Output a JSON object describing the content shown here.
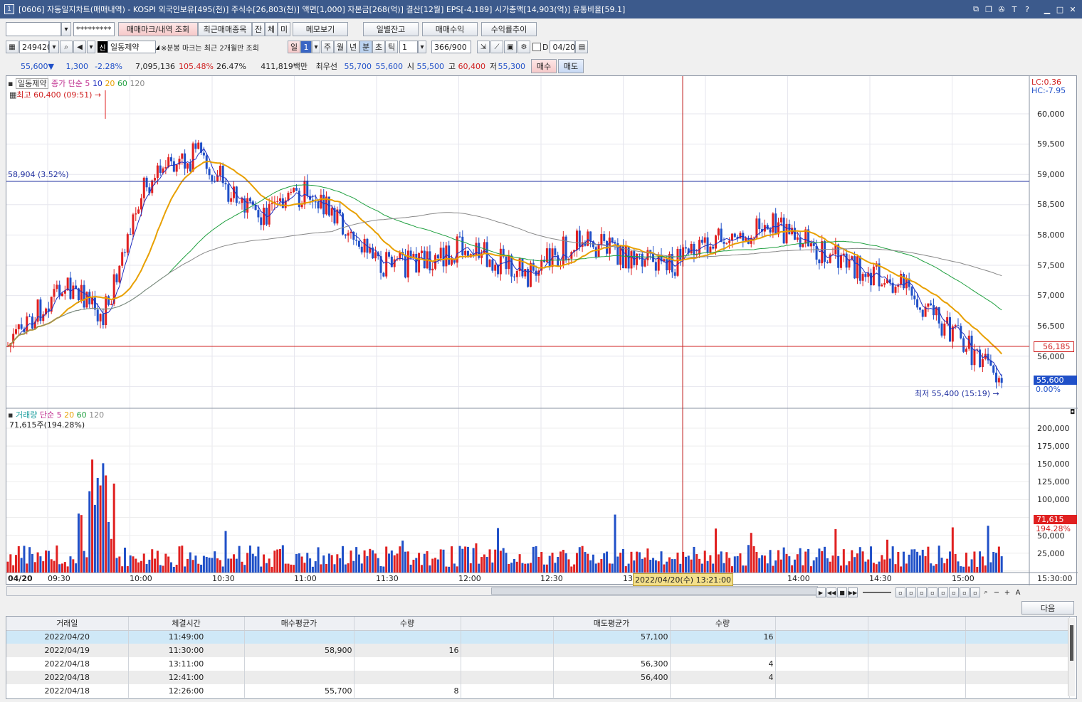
{
  "window": {
    "title": "[0606] 자동일지차트(매매내역) - KOSPI 외국인보유[495(천)] 주식수[26,803(천)] 액면[1,000] 자본금[268(억)] 결산[12월] EPS[-4,189] 시가총액[14,903(억)] 유통비율[59.1]",
    "icon_label": "1"
  },
  "toolbar1": {
    "account_value": "",
    "password_mask": "*********",
    "trade_mark_button": "매매마크/내역 조회",
    "recent_items_button": "최근매매종목",
    "tab_jan": "잔",
    "tab_che": "체",
    "tab_mi": "미",
    "memo_button": "메모보기",
    "daily_balance_button": "일별잔고",
    "trade_profit_button": "매매수익",
    "return_trend_button": "수익률추이"
  },
  "toolbar2": {
    "stock_code": "249420",
    "stock_badge": "신",
    "stock_name": "일동제약",
    "notice": "※분봉 마크는 최근 2개월만 조회",
    "period_day": "일",
    "period_num": "1",
    "period_week": "주",
    "period_month": "월",
    "period_year": "년",
    "period_minute": "분",
    "period_second": "초",
    "period_tick": "틱",
    "interval_value": "1",
    "count_value": "366/900",
    "date_checkbox_label": "D",
    "date_value": "04/20"
  },
  "quote": {
    "price": "55,600▼",
    "change": "1,300",
    "change_pct": "-2.28%",
    "volume": "7,095,136",
    "vol_ratio": "105.48%",
    "turnover": "26.47%",
    "amount": "411,819백만",
    "best_label": "최우선",
    "ask": "55,700",
    "bid": "55,600",
    "open_label": "시",
    "open": "55,500",
    "high_label": "고",
    "high": "60,400",
    "low_label": "저",
    "low": "55,300",
    "buy_button": "매수",
    "sell_button": "매도"
  },
  "price_panel": {
    "stock_label": "일동제약",
    "ma_title": "종가 단순 5",
    "ma_10": "10",
    "ma_20": "20",
    "ma_60": "60",
    "ma_120": "120",
    "high_annot": "최고 60,400 (09:51)",
    "low_annot": "최저 55,400 (15:19)",
    "ref_annot": "58,904 (3.52%)",
    "lc": "LC:0.36",
    "hc": "HC:-7.95",
    "y_ticks": [
      "60,000",
      "59,500",
      "59,000",
      "58,500",
      "58,000",
      "57,500",
      "57,000",
      "56,500",
      "56,000"
    ],
    "current_price_tag": "56,185",
    "last_price_tag": "55,600",
    "last_pct_tag": "0.00%"
  },
  "volume_panel": {
    "title": "거래량",
    "ma_title": "단순 5",
    "ma_20": "20",
    "ma_60": "60",
    "ma_120": "120",
    "last_volume": "71,615주(194.28%)",
    "y_ticks": [
      "200,000",
      "175,000",
      "150,000",
      "125,000",
      "100,000",
      "75,000",
      "50,000",
      "25,000"
    ],
    "vol_tag": "71,615",
    "vol_pct_tag": "194.28%"
  },
  "x_axis": {
    "date": "04/20",
    "ticks": [
      "09:30",
      "10:00",
      "10:30",
      "11:00",
      "11:30",
      "12:00",
      "12:30",
      "13:00",
      "14:00",
      "14:30",
      "15:00"
    ],
    "end_time": "15:30:00",
    "crosshair_label": "2022/04/20(수) 13:21:00"
  },
  "colors": {
    "up": "#e02020",
    "down": "#2050c8",
    "ma5": "#2030c0",
    "ma20": "#e8a000",
    "ma60": "#20a040",
    "ma120": "#888888"
  },
  "table": {
    "next_button": "다음",
    "headers": [
      "거래일",
      "체결시간",
      "매수평균가",
      "수량",
      "",
      "매도평균가",
      "수량",
      "",
      "",
      ""
    ],
    "rows": [
      [
        "2022/04/20",
        "11:49:00",
        "",
        "",
        "",
        "57,100",
        "16",
        "",
        "",
        ""
      ],
      [
        "2022/04/19",
        "11:30:00",
        "58,900",
        "16",
        "",
        "",
        "",
        "",
        "",
        ""
      ],
      [
        "2022/04/18",
        "13:11:00",
        "",
        "",
        "",
        "56,300",
        "4",
        "",
        "",
        ""
      ],
      [
        "2022/04/18",
        "12:41:00",
        "",
        "",
        "",
        "56,400",
        "4",
        "",
        "",
        ""
      ],
      [
        "2022/04/18",
        "12:26:00",
        "55,700",
        "8",
        "",
        "",
        "",
        "",
        "",
        ""
      ]
    ]
  }
}
